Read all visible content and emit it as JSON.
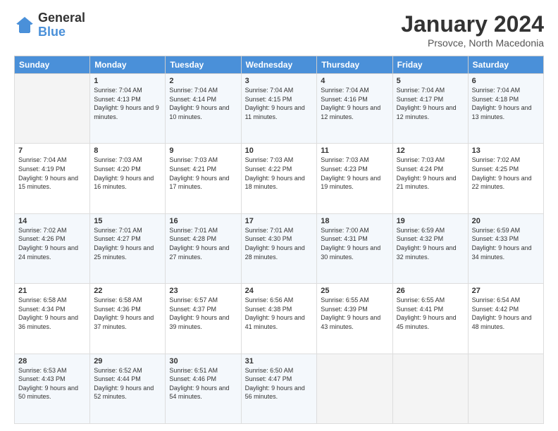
{
  "header": {
    "logo_general": "General",
    "logo_blue": "Blue",
    "month_title": "January 2024",
    "subtitle": "Prsovce, North Macedonia"
  },
  "days_of_week": [
    "Sunday",
    "Monday",
    "Tuesday",
    "Wednesday",
    "Thursday",
    "Friday",
    "Saturday"
  ],
  "weeks": [
    [
      {
        "day": "",
        "sunrise": "",
        "sunset": "",
        "daylight": ""
      },
      {
        "day": "1",
        "sunrise": "Sunrise: 7:04 AM",
        "sunset": "Sunset: 4:13 PM",
        "daylight": "Daylight: 9 hours and 9 minutes."
      },
      {
        "day": "2",
        "sunrise": "Sunrise: 7:04 AM",
        "sunset": "Sunset: 4:14 PM",
        "daylight": "Daylight: 9 hours and 10 minutes."
      },
      {
        "day": "3",
        "sunrise": "Sunrise: 7:04 AM",
        "sunset": "Sunset: 4:15 PM",
        "daylight": "Daylight: 9 hours and 11 minutes."
      },
      {
        "day": "4",
        "sunrise": "Sunrise: 7:04 AM",
        "sunset": "Sunset: 4:16 PM",
        "daylight": "Daylight: 9 hours and 12 minutes."
      },
      {
        "day": "5",
        "sunrise": "Sunrise: 7:04 AM",
        "sunset": "Sunset: 4:17 PM",
        "daylight": "Daylight: 9 hours and 12 minutes."
      },
      {
        "day": "6",
        "sunrise": "Sunrise: 7:04 AM",
        "sunset": "Sunset: 4:18 PM",
        "daylight": "Daylight: 9 hours and 13 minutes."
      }
    ],
    [
      {
        "day": "7",
        "sunrise": "Sunrise: 7:04 AM",
        "sunset": "Sunset: 4:19 PM",
        "daylight": "Daylight: 9 hours and 15 minutes."
      },
      {
        "day": "8",
        "sunrise": "Sunrise: 7:03 AM",
        "sunset": "Sunset: 4:20 PM",
        "daylight": "Daylight: 9 hours and 16 minutes."
      },
      {
        "day": "9",
        "sunrise": "Sunrise: 7:03 AM",
        "sunset": "Sunset: 4:21 PM",
        "daylight": "Daylight: 9 hours and 17 minutes."
      },
      {
        "day": "10",
        "sunrise": "Sunrise: 7:03 AM",
        "sunset": "Sunset: 4:22 PM",
        "daylight": "Daylight: 9 hours and 18 minutes."
      },
      {
        "day": "11",
        "sunrise": "Sunrise: 7:03 AM",
        "sunset": "Sunset: 4:23 PM",
        "daylight": "Daylight: 9 hours and 19 minutes."
      },
      {
        "day": "12",
        "sunrise": "Sunrise: 7:03 AM",
        "sunset": "Sunset: 4:24 PM",
        "daylight": "Daylight: 9 hours and 21 minutes."
      },
      {
        "day": "13",
        "sunrise": "Sunrise: 7:02 AM",
        "sunset": "Sunset: 4:25 PM",
        "daylight": "Daylight: 9 hours and 22 minutes."
      }
    ],
    [
      {
        "day": "14",
        "sunrise": "Sunrise: 7:02 AM",
        "sunset": "Sunset: 4:26 PM",
        "daylight": "Daylight: 9 hours and 24 minutes."
      },
      {
        "day": "15",
        "sunrise": "Sunrise: 7:01 AM",
        "sunset": "Sunset: 4:27 PM",
        "daylight": "Daylight: 9 hours and 25 minutes."
      },
      {
        "day": "16",
        "sunrise": "Sunrise: 7:01 AM",
        "sunset": "Sunset: 4:28 PM",
        "daylight": "Daylight: 9 hours and 27 minutes."
      },
      {
        "day": "17",
        "sunrise": "Sunrise: 7:01 AM",
        "sunset": "Sunset: 4:30 PM",
        "daylight": "Daylight: 9 hours and 28 minutes."
      },
      {
        "day": "18",
        "sunrise": "Sunrise: 7:00 AM",
        "sunset": "Sunset: 4:31 PM",
        "daylight": "Daylight: 9 hours and 30 minutes."
      },
      {
        "day": "19",
        "sunrise": "Sunrise: 6:59 AM",
        "sunset": "Sunset: 4:32 PM",
        "daylight": "Daylight: 9 hours and 32 minutes."
      },
      {
        "day": "20",
        "sunrise": "Sunrise: 6:59 AM",
        "sunset": "Sunset: 4:33 PM",
        "daylight": "Daylight: 9 hours and 34 minutes."
      }
    ],
    [
      {
        "day": "21",
        "sunrise": "Sunrise: 6:58 AM",
        "sunset": "Sunset: 4:34 PM",
        "daylight": "Daylight: 9 hours and 36 minutes."
      },
      {
        "day": "22",
        "sunrise": "Sunrise: 6:58 AM",
        "sunset": "Sunset: 4:36 PM",
        "daylight": "Daylight: 9 hours and 37 minutes."
      },
      {
        "day": "23",
        "sunrise": "Sunrise: 6:57 AM",
        "sunset": "Sunset: 4:37 PM",
        "daylight": "Daylight: 9 hours and 39 minutes."
      },
      {
        "day": "24",
        "sunrise": "Sunrise: 6:56 AM",
        "sunset": "Sunset: 4:38 PM",
        "daylight": "Daylight: 9 hours and 41 minutes."
      },
      {
        "day": "25",
        "sunrise": "Sunrise: 6:55 AM",
        "sunset": "Sunset: 4:39 PM",
        "daylight": "Daylight: 9 hours and 43 minutes."
      },
      {
        "day": "26",
        "sunrise": "Sunrise: 6:55 AM",
        "sunset": "Sunset: 4:41 PM",
        "daylight": "Daylight: 9 hours and 45 minutes."
      },
      {
        "day": "27",
        "sunrise": "Sunrise: 6:54 AM",
        "sunset": "Sunset: 4:42 PM",
        "daylight": "Daylight: 9 hours and 48 minutes."
      }
    ],
    [
      {
        "day": "28",
        "sunrise": "Sunrise: 6:53 AM",
        "sunset": "Sunset: 4:43 PM",
        "daylight": "Daylight: 9 hours and 50 minutes."
      },
      {
        "day": "29",
        "sunrise": "Sunrise: 6:52 AM",
        "sunset": "Sunset: 4:44 PM",
        "daylight": "Daylight: 9 hours and 52 minutes."
      },
      {
        "day": "30",
        "sunrise": "Sunrise: 6:51 AM",
        "sunset": "Sunset: 4:46 PM",
        "daylight": "Daylight: 9 hours and 54 minutes."
      },
      {
        "day": "31",
        "sunrise": "Sunrise: 6:50 AM",
        "sunset": "Sunset: 4:47 PM",
        "daylight": "Daylight: 9 hours and 56 minutes."
      },
      {
        "day": "",
        "sunrise": "",
        "sunset": "",
        "daylight": ""
      },
      {
        "day": "",
        "sunrise": "",
        "sunset": "",
        "daylight": ""
      },
      {
        "day": "",
        "sunrise": "",
        "sunset": "",
        "daylight": ""
      }
    ]
  ]
}
